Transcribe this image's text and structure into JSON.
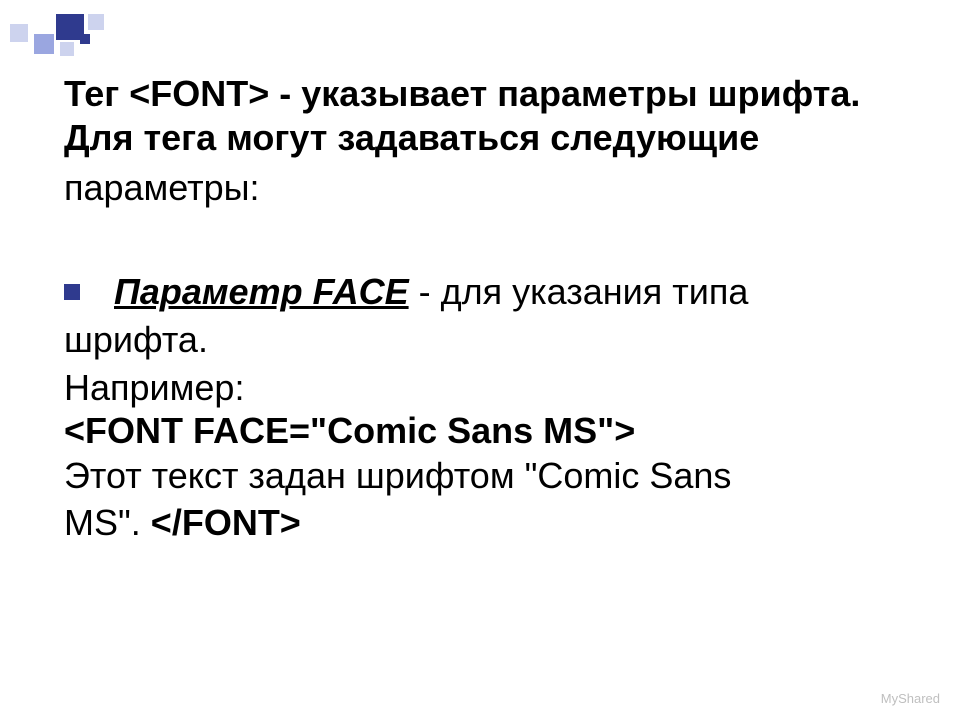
{
  "intro": {
    "prefix": "Тег ",
    "tag": "<FONT>",
    "rest1": " - указывает параметры шрифта.",
    "line2": "Для тега могут задаваться следующие",
    "params": "параметры:"
  },
  "bullet": {
    "param_name": "Параметр FACE",
    "rest": " - для указания типа"
  },
  "after_bullet": "шрифта.",
  "example_label": "Например:",
  "code_open": "<FONT FACE=\"Comic Sans MS\">",
  "comic_line1": "Этот текст задан шрифтом \"Comic Sans",
  "comic_line2_prefix": "MS\".  ",
  "code_close": "</FONT>",
  "footer": "MyShared"
}
